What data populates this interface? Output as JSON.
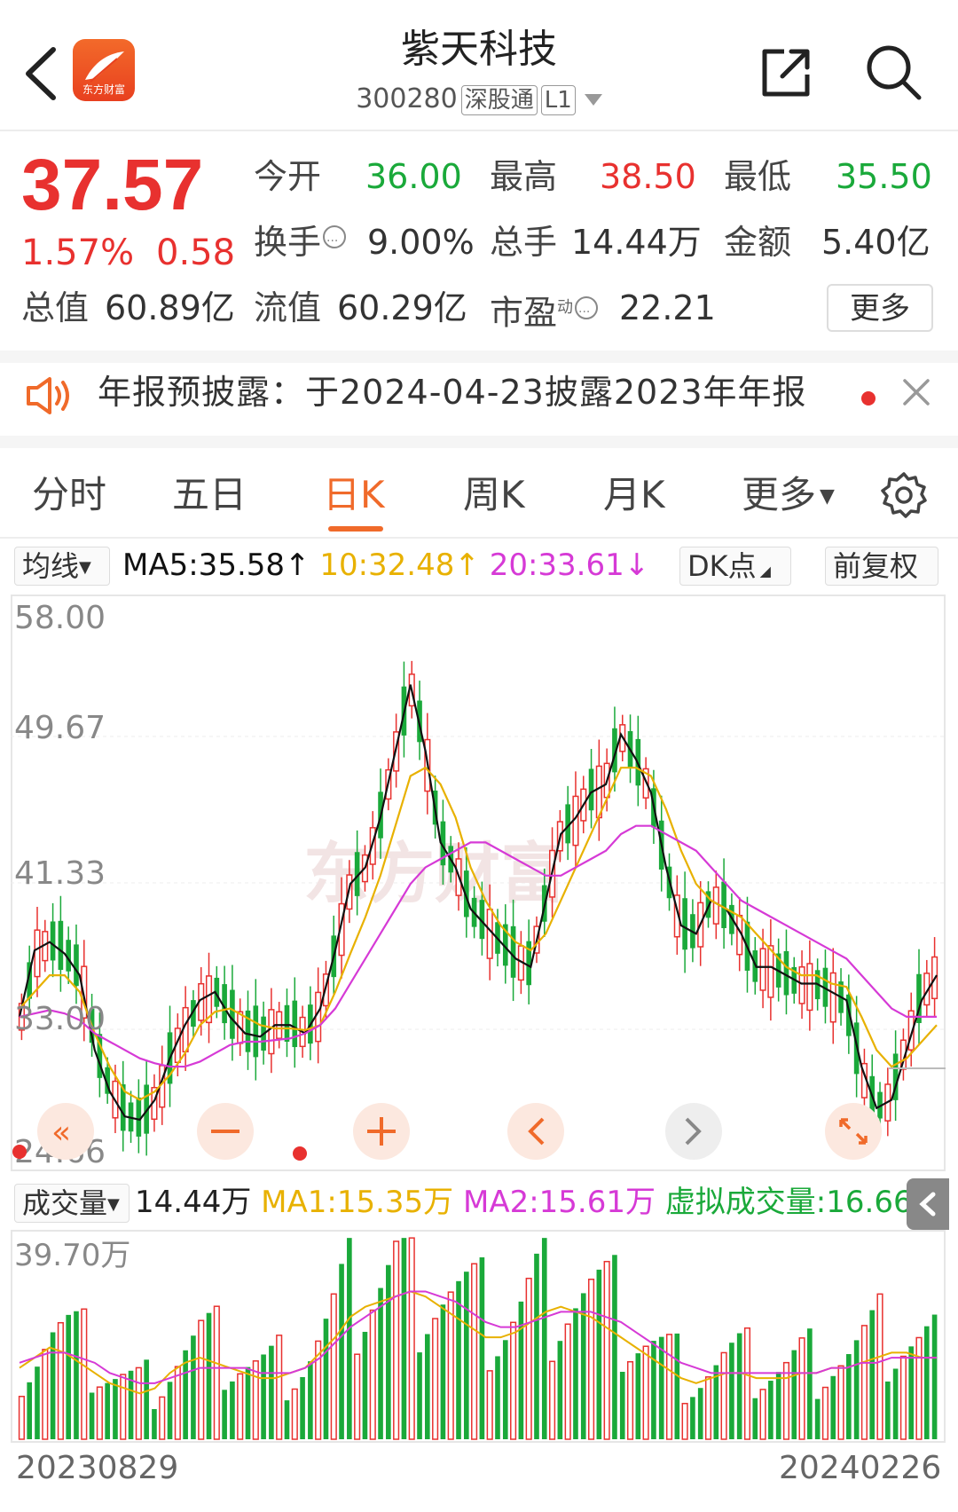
{
  "header": {
    "logo_text": "东方财富",
    "title": "紫天科技",
    "code": "300280",
    "tag1": "深股通",
    "tag2": "L1"
  },
  "quote": {
    "price": "37.57",
    "change_pct": "1.57%",
    "change": "0.58",
    "open_label": "今开",
    "open": "36.00",
    "high_label": "最高",
    "high": "38.50",
    "low_label": "最低",
    "low": "35.50",
    "turnover_label": "换手",
    "turnover": "9.00%",
    "volume_label": "总手",
    "volume": "14.44万",
    "amount_label": "金额",
    "amount": "5.40亿",
    "mktcap_label": "总值",
    "mktcap": "60.89亿",
    "float_label": "流值",
    "float": "60.29亿",
    "pe_label": "市盈",
    "pe_super": "动",
    "pe": "22.21",
    "more": "更多"
  },
  "notice": {
    "text": "年报预披露：于2024-04-23披露2023年年报"
  },
  "tabs": [
    "分时",
    "五日",
    "日K",
    "周K",
    "月K",
    "更多"
  ],
  "ma": {
    "selector": "均线",
    "ma5": "MA5:35.58",
    "ma10": "10:32.48",
    "ma20": "20:33.61",
    "dk": "DK点",
    "adjust": "前复权"
  },
  "volume_bar": {
    "selector": "成交量",
    "value": "14.44万",
    "ma1": "MA1:15.35万",
    "ma2": "MA2:15.61万",
    "virtual": "虚拟成交量:16.66万"
  },
  "colors": {
    "up": "#e8312f",
    "down": "#1aa93a",
    "accent": "#f06a2a",
    "ma5": "#111111",
    "ma10": "#e8b100",
    "ma20": "#d63ad6"
  },
  "chart_data": [
    {
      "type": "candlestick",
      "title": "",
      "y_ticks": [
        "58.00",
        "49.67",
        "41.33",
        "33.00",
        "24.66"
      ],
      "ylim": [
        24.66,
        58.0
      ],
      "x_range": [
        "20230829",
        "20240226"
      ],
      "series": [
        {
          "name": "MA5",
          "values": [
            33,
            37,
            37.5,
            36.8,
            35.5,
            31,
            28.5,
            27,
            26.8,
            28,
            30.5,
            32.5,
            34,
            34.5,
            33,
            32,
            31.8,
            32.5,
            32.5,
            32,
            33.5,
            37,
            41,
            42,
            45,
            49,
            53,
            49,
            43.5,
            42,
            39.5,
            38.5,
            37.5,
            36.5,
            36,
            40,
            44,
            45,
            46.5,
            47,
            50,
            48.5,
            46.5,
            42,
            38.5,
            38,
            40,
            39.5,
            38,
            36,
            36,
            35.5,
            35,
            35,
            34.5,
            34,
            30,
            27.5,
            28,
            31,
            34,
            35.5
          ]
        },
        {
          "name": "MA10",
          "values": [
            33.5,
            34.5,
            35.5,
            35.5,
            34.5,
            32,
            30,
            28.5,
            28,
            28.5,
            29.5,
            30.8,
            32.5,
            33.3,
            33.5,
            33,
            32.5,
            32.3,
            32.3,
            32.2,
            32.5,
            34.5,
            36.8,
            39,
            41.5,
            44.5,
            47.5,
            48,
            47,
            45,
            42,
            40,
            38.5,
            37.5,
            37,
            38,
            40,
            42,
            44,
            46,
            48,
            48,
            47.5,
            45.5,
            43,
            41,
            40,
            39.5,
            39,
            38,
            37,
            36,
            35.5,
            35.5,
            35,
            34.8,
            33,
            31,
            30,
            30.5,
            31.5,
            32.5
          ]
        },
        {
          "name": "MA20",
          "values": [
            33,
            33.2,
            33.4,
            33.2,
            32.8,
            32,
            31.5,
            31,
            30.5,
            30.2,
            30,
            30,
            30.3,
            30.8,
            31.3,
            31.5,
            31.5,
            31.6,
            31.7,
            32,
            32.5,
            33.5,
            35,
            36.5,
            38,
            39.5,
            41,
            42,
            42.5,
            43,
            43.5,
            43.5,
            43,
            42.5,
            42,
            41.5,
            41.5,
            42,
            42.5,
            43,
            44,
            44.5,
            44.5,
            44,
            43.5,
            43,
            42,
            41,
            40,
            39.5,
            39,
            38.5,
            38,
            37.5,
            37,
            36.5,
            35.5,
            34.5,
            33.5,
            33,
            33,
            33
          ]
        }
      ]
    },
    {
      "type": "bar",
      "title": "",
      "y_ticks": [
        "39.70万"
      ],
      "ylim": [
        0,
        39.7
      ],
      "series": [
        {
          "name": "MA1",
          "values": [
            14,
            16,
            18,
            17,
            15,
            13,
            11,
            10,
            9,
            10,
            13,
            15,
            16,
            15,
            14,
            13,
            12,
            12,
            13,
            14,
            17,
            20,
            24,
            26,
            27,
            28,
            29,
            28,
            26,
            24,
            22,
            20,
            20,
            21,
            23,
            25,
            26,
            25,
            24,
            22,
            20,
            18,
            16,
            14,
            12,
            11,
            12,
            13,
            13,
            12,
            12,
            12,
            13,
            13,
            14,
            14,
            15,
            16,
            17,
            17,
            16,
            16
          ]
        },
        {
          "name": "MA2",
          "values": [
            15,
            16,
            17,
            17,
            16,
            15,
            13,
            12,
            11,
            11,
            12,
            13,
            14,
            14,
            14,
            14,
            13,
            13,
            13,
            14,
            16,
            19,
            22,
            24,
            26,
            28,
            29,
            29,
            28,
            27,
            25,
            23,
            22,
            22,
            23,
            24,
            25,
            25,
            25,
            24,
            23,
            21,
            19,
            17,
            15,
            14,
            13,
            13,
            13,
            13,
            13,
            13,
            13,
            13,
            14,
            14,
            15,
            15,
            16,
            16,
            16,
            16
          ]
        }
      ]
    }
  ]
}
